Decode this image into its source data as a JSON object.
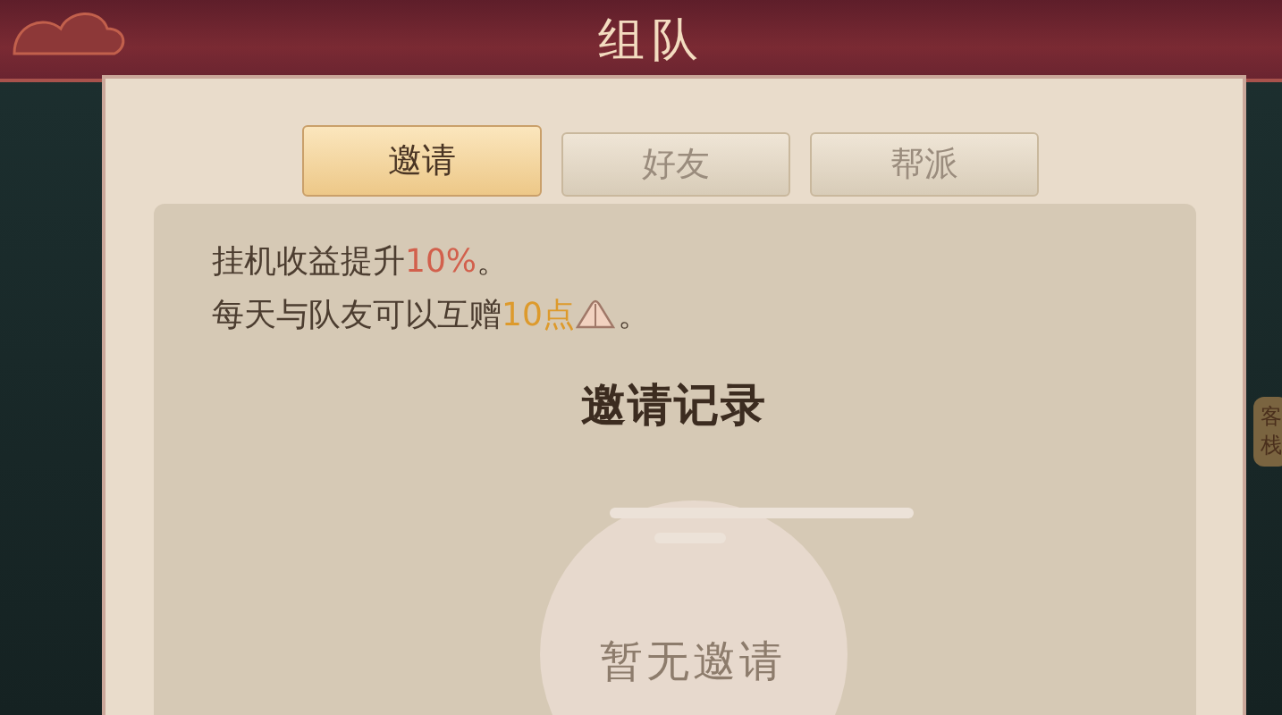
{
  "window": {
    "title": "组队"
  },
  "tabs": [
    {
      "label": "邀请",
      "selected": true
    },
    {
      "label": "好友",
      "selected": false
    },
    {
      "label": "帮派",
      "selected": false
    }
  ],
  "info_lines": [
    {
      "parts": [
        {
          "kind": "text",
          "text": "挂机收益提升"
        },
        {
          "kind": "text",
          "text": "10%",
          "color": "#d2604c"
        },
        {
          "kind": "text",
          "text": "。"
        }
      ]
    },
    {
      "parts": [
        {
          "kind": "text",
          "text": "每天与队友可以互赠"
        },
        {
          "kind": "text",
          "text": "10点",
          "color": "#dd9a2c"
        },
        {
          "kind": "icon"
        },
        {
          "kind": "text",
          "text": "。"
        }
      ]
    }
  ],
  "section_title": "邀请记录",
  "empty_state": "暂无邀请",
  "background_sign": "客栈"
}
